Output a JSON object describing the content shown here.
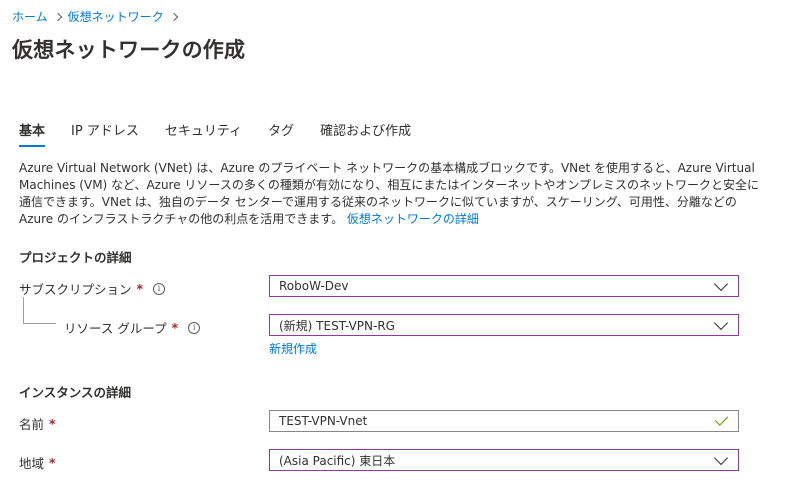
{
  "breadcrumb": {
    "items": [
      "ホーム",
      "仮想ネットワーク"
    ]
  },
  "page": {
    "title": "仮想ネットワークの作成"
  },
  "tabs": [
    "基本",
    "IP アドレス",
    "セキュリティ",
    "タグ",
    "確認および作成"
  ],
  "description": {
    "text": "Azure Virtual Network (VNet) は、Azure のプライベート ネットワークの基本構成ブロックです。VNet を使用すると、Azure Virtual Machines (VM) など、Azure リソースの多くの種類が有効になり、相互にまたはインターネットやオンプレミスのネットワークと安全に通信できます。VNet は、独自のデータ センターで運用する従来のネットワークに似ていますが、スケーリング、可用性、分離などの Azure のインフラストラクチャの他の利点を活用できます。",
    "link": "仮想ネットワークの詳細"
  },
  "project": {
    "heading": "プロジェクトの詳細",
    "subscription_label": "サブスクリプション",
    "subscription_value": "RoboW-Dev",
    "resource_group_label": "リソース グループ",
    "resource_group_value": "(新規) TEST-VPN-RG",
    "create_new": "新規作成"
  },
  "instance": {
    "heading": "インスタンスの詳細",
    "name_label": "名前",
    "name_value": "TEST-VPN-Vnet",
    "region_label": "地域",
    "region_value": "(Asia Pacific) 東日本"
  },
  "required_mark": "*",
  "info_glyph": "i",
  "colors": {
    "accent": "#0078d4",
    "required": "#a4262c",
    "focus_border": "#8a3d9b",
    "valid": "#57a300"
  }
}
